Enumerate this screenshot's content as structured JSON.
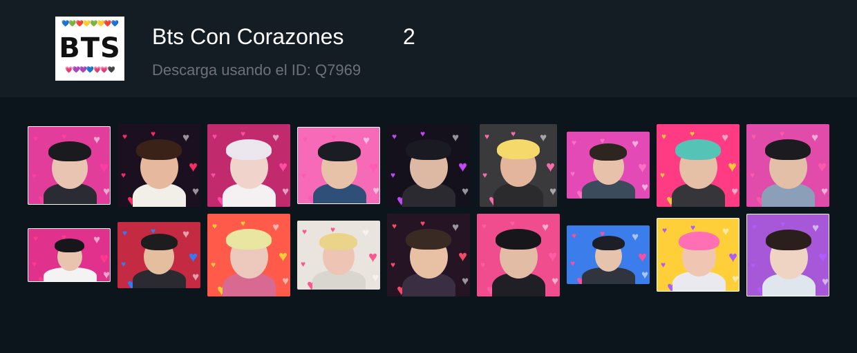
{
  "pack": {
    "title": "Bts Con Corazones",
    "count": "2",
    "subtitle": "Descarga usando el ID: Q7969",
    "logo": {
      "text": "BTS",
      "hearts_top": "💙💚❤️💛💚💛❤️💙",
      "hearts_bottom": "💗💜💜💙💗💗🖤"
    }
  },
  "stickers": [
    {
      "name": "sticker-1",
      "bg": "#e23d9a",
      "hair": "#1a1a1f",
      "skin": "#e9c4b3",
      "cloth": "#2b2b33",
      "heart": "#ff3fa0"
    },
    {
      "name": "sticker-2",
      "bg": "#1a1020",
      "hair": "#3a2218",
      "skin": "#e6b89e",
      "cloth": "#f2efe9",
      "heart": "#ff2f6a"
    },
    {
      "name": "sticker-3",
      "bg": "#c22a6e",
      "hair": "#ece7ee",
      "skin": "#f0d4cc",
      "cloth": "#f5f1f3",
      "heart": "#ff4fa8"
    },
    {
      "name": "sticker-4",
      "bg": "#f66ab8",
      "hair": "#1b1d24",
      "skin": "#e7c2a8",
      "cloth": "#2f4f78",
      "heart": "#ff5ab4"
    },
    {
      "name": "sticker-5",
      "bg": "#15111c",
      "hair": "#1a1a22",
      "skin": "#ddb9a4",
      "cloth": "#2a2a30",
      "heart": "#c94cff"
    },
    {
      "name": "sticker-6",
      "bg": "#3a3a3c",
      "hair": "#f5d96a",
      "skin": "#e2b59c",
      "cloth": "#2b2b2e",
      "heart": "#ff6fb0"
    },
    {
      "name": "sticker-7",
      "bg": "#e34ab5",
      "hair": "#2e2420",
      "skin": "#e8c1aa",
      "cloth": "#3b4b5c",
      "heart": "#ff74c6"
    },
    {
      "name": "sticker-8",
      "bg": "#ff3b84",
      "hair": "#55c4b6",
      "skin": "#e6c0a6",
      "cloth": "#36363a",
      "heart": "#ffcf33"
    },
    {
      "name": "sticker-9",
      "bg": "#e14caa",
      "hair": "#1c1c20",
      "skin": "#e3bfa8",
      "cloth": "#8ba0b8",
      "heart": "#ff5aa8"
    },
    {
      "name": "sticker-10",
      "bg": "#e0328c",
      "hair": "#16161b",
      "skin": "#e8c3ad",
      "cloth": "#f3f3f3",
      "heart": "#ff3a8c"
    },
    {
      "name": "sticker-11",
      "bg": "#c42a42",
      "hair": "#1d1c1f",
      "skin": "#e5bea0",
      "cloth": "#2a2a30",
      "heart": "#2f7dff"
    },
    {
      "name": "sticker-12",
      "bg": "#ff5a4a",
      "hair": "#e8e6a0",
      "skin": "#ecc8bd",
      "cloth": "#d86a92",
      "heart": "#ffd23a"
    },
    {
      "name": "sticker-13",
      "bg": "#e9e4de",
      "hair": "#e9d48a",
      "skin": "#eec5b4",
      "cloth": "#d9d5cf",
      "heart": "#ff4f8c"
    },
    {
      "name": "sticker-14",
      "bg": "#241424",
      "hair": "#3a2a24",
      "skin": "#e8c0a4",
      "cloth": "#3a2e42",
      "heart": "#ff4f6c"
    },
    {
      "name": "sticker-15",
      "bg": "#ef4d8e",
      "hair": "#17171b",
      "skin": "#e2bca5",
      "cloth": "#1f1f25",
      "heart": "#ff5ea6"
    },
    {
      "name": "sticker-16",
      "bg": "#3b7dea",
      "hair": "#1d1f26",
      "skin": "#e6c3ac",
      "cloth": "#30343e",
      "heart": "#ff4f9e"
    },
    {
      "name": "sticker-17",
      "bg": "#ffcf3a",
      "hair": "#ff6fb4",
      "skin": "#f0c6b2",
      "cloth": "#e9e9ef",
      "heart": "#a55bff"
    },
    {
      "name": "sticker-18",
      "bg": "#a758d9",
      "hair": "#2a1f1c",
      "skin": "#efd3c3",
      "cloth": "#dfe6ee",
      "heart": "#b05cff"
    }
  ]
}
